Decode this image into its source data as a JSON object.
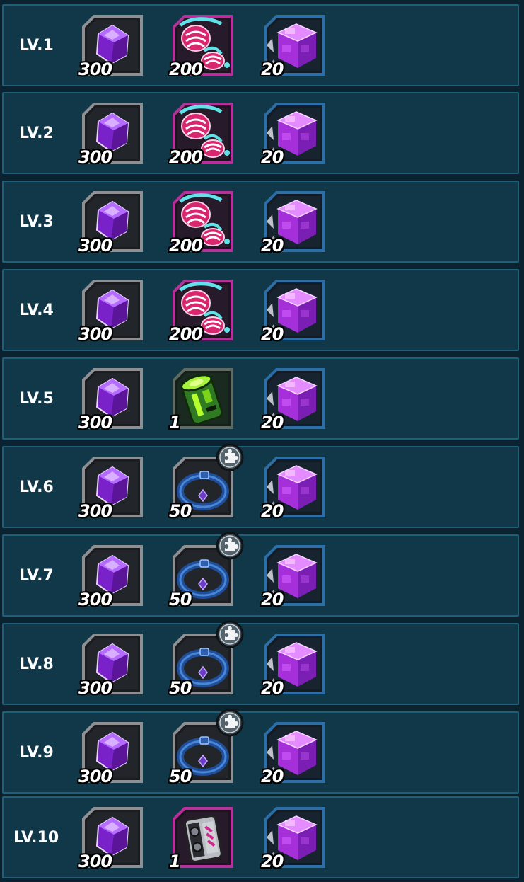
{
  "colors": {
    "background": "#0b2230",
    "row_fill": "#113848",
    "row_border": "#1f6079",
    "frame_gray": "#8a8a8a",
    "frame_magenta": "#c03aa0",
    "frame_blue": "#2a6fa8",
    "gem": "#9b3ef0",
    "cube": "#c84cf5"
  },
  "rows": [
    {
      "level": "LV.1",
      "items": [
        {
          "icon": "purple-gem-icon",
          "qty": "300"
        },
        {
          "icon": "pink-shell-goggles-icon",
          "qty": "200"
        },
        {
          "icon": "purple-cube-icon",
          "qty": "20"
        }
      ]
    },
    {
      "level": "LV.2",
      "items": [
        {
          "icon": "purple-gem-icon",
          "qty": "300"
        },
        {
          "icon": "pink-shell-goggles-icon",
          "qty": "200"
        },
        {
          "icon": "purple-cube-icon",
          "qty": "20"
        }
      ]
    },
    {
      "level": "LV.3",
      "items": [
        {
          "icon": "purple-gem-icon",
          "qty": "300"
        },
        {
          "icon": "pink-shell-goggles-icon",
          "qty": "200"
        },
        {
          "icon": "purple-cube-icon",
          "qty": "20"
        }
      ]
    },
    {
      "level": "LV.4",
      "items": [
        {
          "icon": "purple-gem-icon",
          "qty": "300"
        },
        {
          "icon": "pink-shell-goggles-icon",
          "qty": "200"
        },
        {
          "icon": "purple-cube-icon",
          "qty": "20"
        }
      ]
    },
    {
      "level": "LV.5",
      "items": [
        {
          "icon": "purple-gem-icon",
          "qty": "300"
        },
        {
          "icon": "green-canister-icon",
          "qty": "1"
        },
        {
          "icon": "purple-cube-icon",
          "qty": "20"
        }
      ]
    },
    {
      "level": "LV.6",
      "items": [
        {
          "icon": "purple-gem-icon",
          "qty": "300"
        },
        {
          "icon": "blue-collar-fragment-icon",
          "qty": "50"
        },
        {
          "icon": "purple-cube-icon",
          "qty": "20"
        }
      ]
    },
    {
      "level": "LV.7",
      "items": [
        {
          "icon": "purple-gem-icon",
          "qty": "300"
        },
        {
          "icon": "blue-collar-fragment-icon",
          "qty": "50"
        },
        {
          "icon": "purple-cube-icon",
          "qty": "20"
        }
      ]
    },
    {
      "level": "LV.8",
      "items": [
        {
          "icon": "purple-gem-icon",
          "qty": "300"
        },
        {
          "icon": "blue-collar-fragment-icon",
          "qty": "50"
        },
        {
          "icon": "purple-cube-icon",
          "qty": "20"
        }
      ]
    },
    {
      "level": "LV.9",
      "items": [
        {
          "icon": "purple-gem-icon",
          "qty": "300"
        },
        {
          "icon": "blue-collar-fragment-icon",
          "qty": "50"
        },
        {
          "icon": "purple-cube-icon",
          "qty": "20"
        }
      ]
    },
    {
      "level": "LV.10",
      "items": [
        {
          "icon": "purple-gem-icon",
          "qty": "300"
        },
        {
          "icon": "camera-device-icon",
          "qty": "1"
        },
        {
          "icon": "purple-cube-icon",
          "qty": "20"
        }
      ]
    }
  ]
}
